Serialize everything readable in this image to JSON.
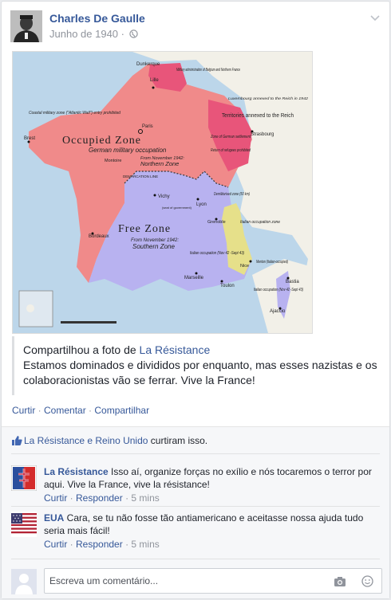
{
  "post": {
    "author": "Charles De Gaulle",
    "date": "Junho de 1940",
    "shared_prefix": "Compartilhou a foto de ",
    "shared_page": "La Résistance",
    "text": "Estamos dominados e divididos por enquanto, mas esses nazistas e os colaboracionistas vão se ferrar. Vive la France!"
  },
  "map": {
    "labels": {
      "dunkerque": "Dunkerque",
      "lille": "Lille",
      "military_admin": "Military administration of Belgium and Northern France",
      "luxembourg": "Luxembourg annexed to the Reich in 1942",
      "coastal_zone": "Coastal military zone (\"Atlantic Wall\") entry prohibited",
      "territories_annexed": "Territories annexed to the Reich",
      "paris": "Paris",
      "strasbourg": "Strasbourg",
      "brest": "Brest",
      "german_settlement": "Zone of German settlement",
      "refugees_prohibited": "Return of refugees prohibited",
      "occupied_zone": "Occupied Zone",
      "german_military_occupation": "German military occupation",
      "from_nov_1942_a": "From November 1942:",
      "northern_zone": "Northern Zone",
      "montoire": "Montoire",
      "demarcation_line": "DEMARCATION LINE",
      "vichy": "Vichy",
      "vichy_sub": "(seat of government)",
      "demilitarised": "Demilitarised zone (50 km)",
      "lyon": "Lyon",
      "grenoble": "Grenoble",
      "italian_zone": "Italian occupation zone",
      "free_zone": "Free Zone",
      "from_nov_1942_b": "From November 1942:",
      "southern_zone": "Southern Zone",
      "bordeaux": "Bordeaux",
      "italian_occupation": "Italian occupation (Nov 42 -Sept 43)",
      "menton": "Menton (Italian-occupied)",
      "nice": "Nice",
      "marseille": "Marseille",
      "toulon": "Toulon",
      "bastia": "Bastia",
      "corsica_occupation": "Italian occupation (Nov 42 -Sept 43)",
      "ajaccio": "Ajaccio"
    }
  },
  "actions": {
    "like": "Curtir",
    "comment": "Comentar",
    "share": "Compartilhar",
    "sep": " · "
  },
  "likes": {
    "names": "La Résistance e Reino Unido",
    "suffix": " curtiram isso."
  },
  "comments": [
    {
      "author": "La Résistance",
      "text": " Isso aí, organize forças no exílio e nós tocaremos o terror por aqui. Vive la France, vive la résistance!",
      "like": "Curtir",
      "reply": "Responder",
      "time": "5 mins"
    },
    {
      "author": "EUA",
      "text": " Cara, se tu não fosse tão antiamericano e aceitasse nossa ajuda tudo seria mais fácil!",
      "like": "Curtir",
      "reply": "Responder",
      "time": "5 mins"
    }
  ],
  "composer": {
    "placeholder": "Escreva um comentário..."
  },
  "colors": {
    "link": "#365899",
    "occupied": "#f08a8a",
    "free": "#b8b2f0",
    "annexed": "#e8557a",
    "italian": "#e6e08a"
  }
}
